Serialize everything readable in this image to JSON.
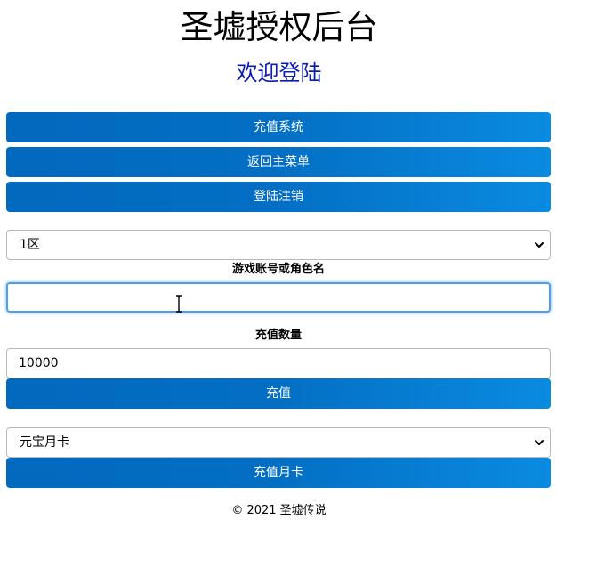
{
  "header": {
    "title": "圣墟授权后台",
    "subtitle": "欢迎登陆"
  },
  "nav": {
    "recharge_system": "充值系统",
    "back_to_menu": "返回主菜单",
    "logout": "登陆注销"
  },
  "server_select": {
    "selected": "1区"
  },
  "account": {
    "label": "游戏账号或角色名",
    "value": "",
    "placeholder": ""
  },
  "amount": {
    "label": "充值数量",
    "value": "10000"
  },
  "recharge_button": "充值",
  "card_select": {
    "selected": "元宝月卡"
  },
  "monthly_card_button": "充值月卡",
  "footer": {
    "copyright": "© 2021 圣墟传说"
  },
  "colors": {
    "button_gradient_start": "#0169be",
    "button_gradient_end": "#0a8be0",
    "subtitle": "#0b1cb0",
    "focus_ring": "#4f9fe8"
  }
}
